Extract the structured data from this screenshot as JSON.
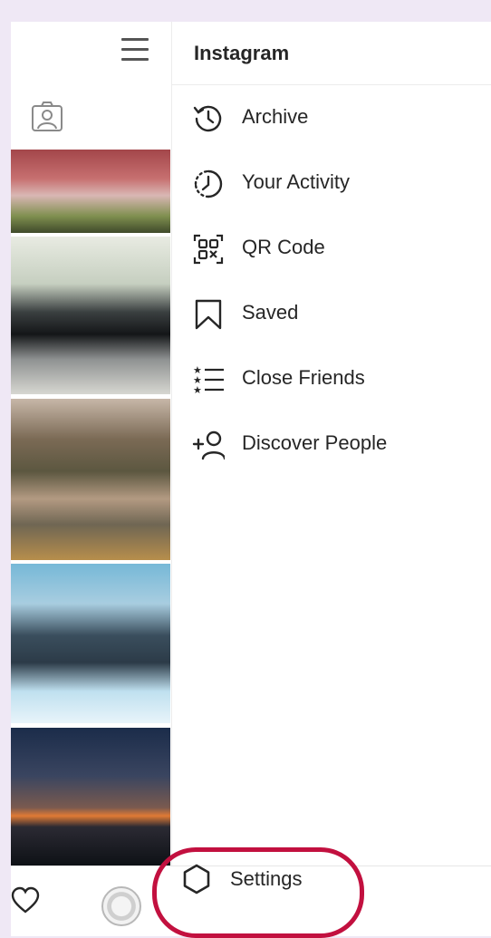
{
  "drawer": {
    "title": "Instagram",
    "items": [
      {
        "label": "Archive",
        "icon": "archive-icon"
      },
      {
        "label": "Your Activity",
        "icon": "activity-icon"
      },
      {
        "label": "QR Code",
        "icon": "qr-code-icon"
      },
      {
        "label": "Saved",
        "icon": "bookmark-icon"
      },
      {
        "label": "Close Friends",
        "icon": "close-friends-icon"
      },
      {
        "label": "Discover People",
        "icon": "add-person-icon"
      }
    ],
    "settings_label": "Settings"
  },
  "highlight_color": "#c2103f"
}
